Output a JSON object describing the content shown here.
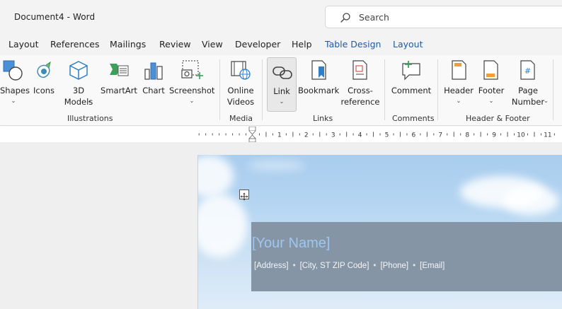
{
  "titlebar": {
    "document_title": "Document4  -  Word",
    "search_placeholder": "Search"
  },
  "tabs": [
    {
      "label": "Layout",
      "contextual": false
    },
    {
      "label": "References",
      "contextual": false
    },
    {
      "label": "Mailings",
      "contextual": false
    },
    {
      "label": "Review",
      "contextual": false
    },
    {
      "label": "View",
      "contextual": false
    },
    {
      "label": "Developer",
      "contextual": false
    },
    {
      "label": "Help",
      "contextual": false
    },
    {
      "label": "Table Design",
      "contextual": true
    },
    {
      "label": "Layout",
      "contextual": true
    }
  ],
  "ribbon": {
    "illustrations": {
      "group_label": "Illustrations",
      "shapes": {
        "label": "Shapes",
        "icon": "shapes-icon"
      },
      "icons": {
        "label": "Icons",
        "icon": "icons-icon"
      },
      "models3d": {
        "label_line1": "3D",
        "label_line2": "Models",
        "icon": "3d-models-icon"
      },
      "smartart": {
        "label": "SmartArt",
        "icon": "smartart-icon"
      },
      "chart": {
        "label": "Chart",
        "icon": "chart-icon"
      },
      "screenshot": {
        "label": "Screenshot",
        "icon": "screenshot-icon"
      }
    },
    "media": {
      "group_label": "Media",
      "online_videos": {
        "label_line1": "Online",
        "label_line2": "Videos",
        "icon": "online-videos-icon"
      }
    },
    "links": {
      "group_label": "Links",
      "link": {
        "label": "Link",
        "icon": "link-icon"
      },
      "bookmark": {
        "label": "Bookmark",
        "icon": "bookmark-icon"
      },
      "cross_reference": {
        "label_line1": "Cross-",
        "label_line2": "reference",
        "icon": "cross-reference-icon"
      }
    },
    "comments": {
      "group_label": "Comments",
      "comment": {
        "label": "Comment",
        "icon": "comment-icon"
      }
    },
    "header_footer": {
      "group_label": "Header & Footer",
      "header": {
        "label": "Header",
        "icon": "header-icon"
      },
      "footer": {
        "label": "Footer",
        "icon": "footer-icon"
      },
      "page_number": {
        "label_line1": "Page",
        "label_line2": "Number",
        "icon": "page-number-icon"
      }
    }
  },
  "ruler": {
    "numbers": [
      "1",
      "2",
      "3",
      "4",
      "5",
      "6",
      "7",
      "8",
      "9",
      "10",
      "11"
    ]
  },
  "document": {
    "your_name": "[Your Name]",
    "contact": {
      "address": "[Address]",
      "city": "[City, ST ZIP Code]",
      "phone": "[Phone]",
      "email": "[Email]",
      "separator": "•"
    }
  },
  "colors": {
    "chrome_background": "#f3f3f3",
    "contextual_tab": "#1f5a9e",
    "header_band": "#8595a6",
    "name_text": "#9fc6ee",
    "sky_top": "#a9cdee"
  }
}
